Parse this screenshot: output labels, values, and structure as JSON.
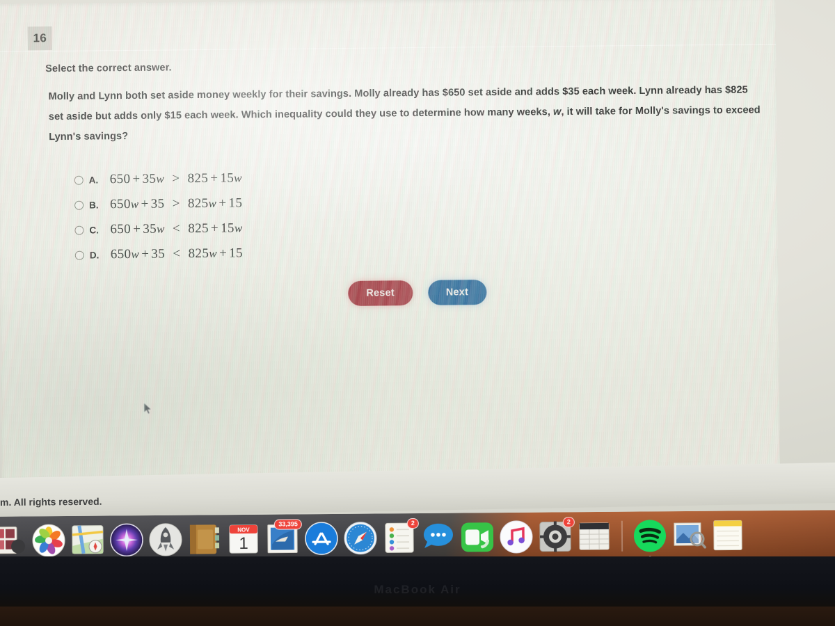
{
  "question": {
    "number": "16",
    "prompt": "Select the correct answer.",
    "stem_part1": "Molly and Lynn both set aside money weekly for their savings. Molly already has $650 set aside and adds $35 each week. Lynn already has $825 set aside but adds only $15 each week. Which inequality could they use to determine how many weeks, ",
    "stem_var": "w",
    "stem_part2": ", it will take for Molly's savings to exceed Lynn's savings?",
    "choices": [
      {
        "letter": "A.",
        "text": "650 + 35w > 825 + 15w",
        "lhs_const": "650",
        "lhs_op": "+",
        "lhs_coef": "35",
        "lhs_var": "w",
        "relation": ">",
        "rhs_const": "825",
        "rhs_op": "+",
        "rhs_coef": "15",
        "rhs_var": "w",
        "selected": false
      },
      {
        "letter": "B.",
        "text": "650w + 35 > 825w + 15",
        "lhs_coef": "650",
        "lhs_var": "w",
        "lhs_op": "+",
        "lhs_const": "35",
        "relation": ">",
        "rhs_coef": "825",
        "rhs_var": "w",
        "rhs_op": "+",
        "rhs_const": "15",
        "selected": false
      },
      {
        "letter": "C.",
        "text": "650 + 35w < 825 + 15w",
        "lhs_const": "650",
        "lhs_op": "+",
        "lhs_coef": "35",
        "lhs_var": "w",
        "relation": "<",
        "rhs_const": "825",
        "rhs_op": "+",
        "rhs_coef": "15",
        "rhs_var": "w",
        "selected": false
      },
      {
        "letter": "D.",
        "text": "650w + 35 < 825w + 15",
        "lhs_coef": "650",
        "lhs_var": "w",
        "lhs_op": "+",
        "lhs_const": "35",
        "relation": "<",
        "rhs_coef": "825",
        "rhs_var": "w",
        "rhs_op": "+",
        "rhs_const": "15",
        "selected": false
      }
    ]
  },
  "buttons": {
    "reset_label": "Reset",
    "next_label": "Next",
    "reset_color": "#a8484f",
    "next_color": "#2f6d9c"
  },
  "footer": {
    "text": "m. All rights reserved."
  },
  "dock": {
    "items": [
      {
        "name": "photo-booth",
        "badge": null,
        "running": false
      },
      {
        "name": "photos",
        "badge": null,
        "running": false
      },
      {
        "name": "maps",
        "badge": null,
        "running": false
      },
      {
        "name": "siri",
        "badge": null,
        "running": false
      },
      {
        "name": "launchpad",
        "badge": null,
        "running": false
      },
      {
        "name": "contacts",
        "badge": null,
        "running": false
      },
      {
        "name": "calendar",
        "badge": null,
        "running": false,
        "month": "NOV",
        "day": "1"
      },
      {
        "name": "mail",
        "badge": "33,395",
        "running": false
      },
      {
        "name": "app-store",
        "badge": null,
        "running": false
      },
      {
        "name": "safari",
        "badge": null,
        "running": true
      },
      {
        "name": "reminders",
        "badge": "2",
        "running": false
      },
      {
        "name": "messages",
        "badge": null,
        "running": false
      },
      {
        "name": "facetime",
        "badge": null,
        "running": false
      },
      {
        "name": "itunes",
        "badge": null,
        "running": false
      },
      {
        "name": "system-preferences",
        "badge": "2",
        "running": false
      },
      {
        "name": "numbers",
        "badge": null,
        "running": false
      },
      {
        "name": "separator",
        "badge": null,
        "running": false
      },
      {
        "name": "spotify",
        "badge": null,
        "running": true
      },
      {
        "name": "preview",
        "badge": null,
        "running": false
      },
      {
        "name": "notes",
        "badge": null,
        "running": false
      }
    ]
  },
  "device": {
    "bezel_label": "MacBook Air"
  }
}
